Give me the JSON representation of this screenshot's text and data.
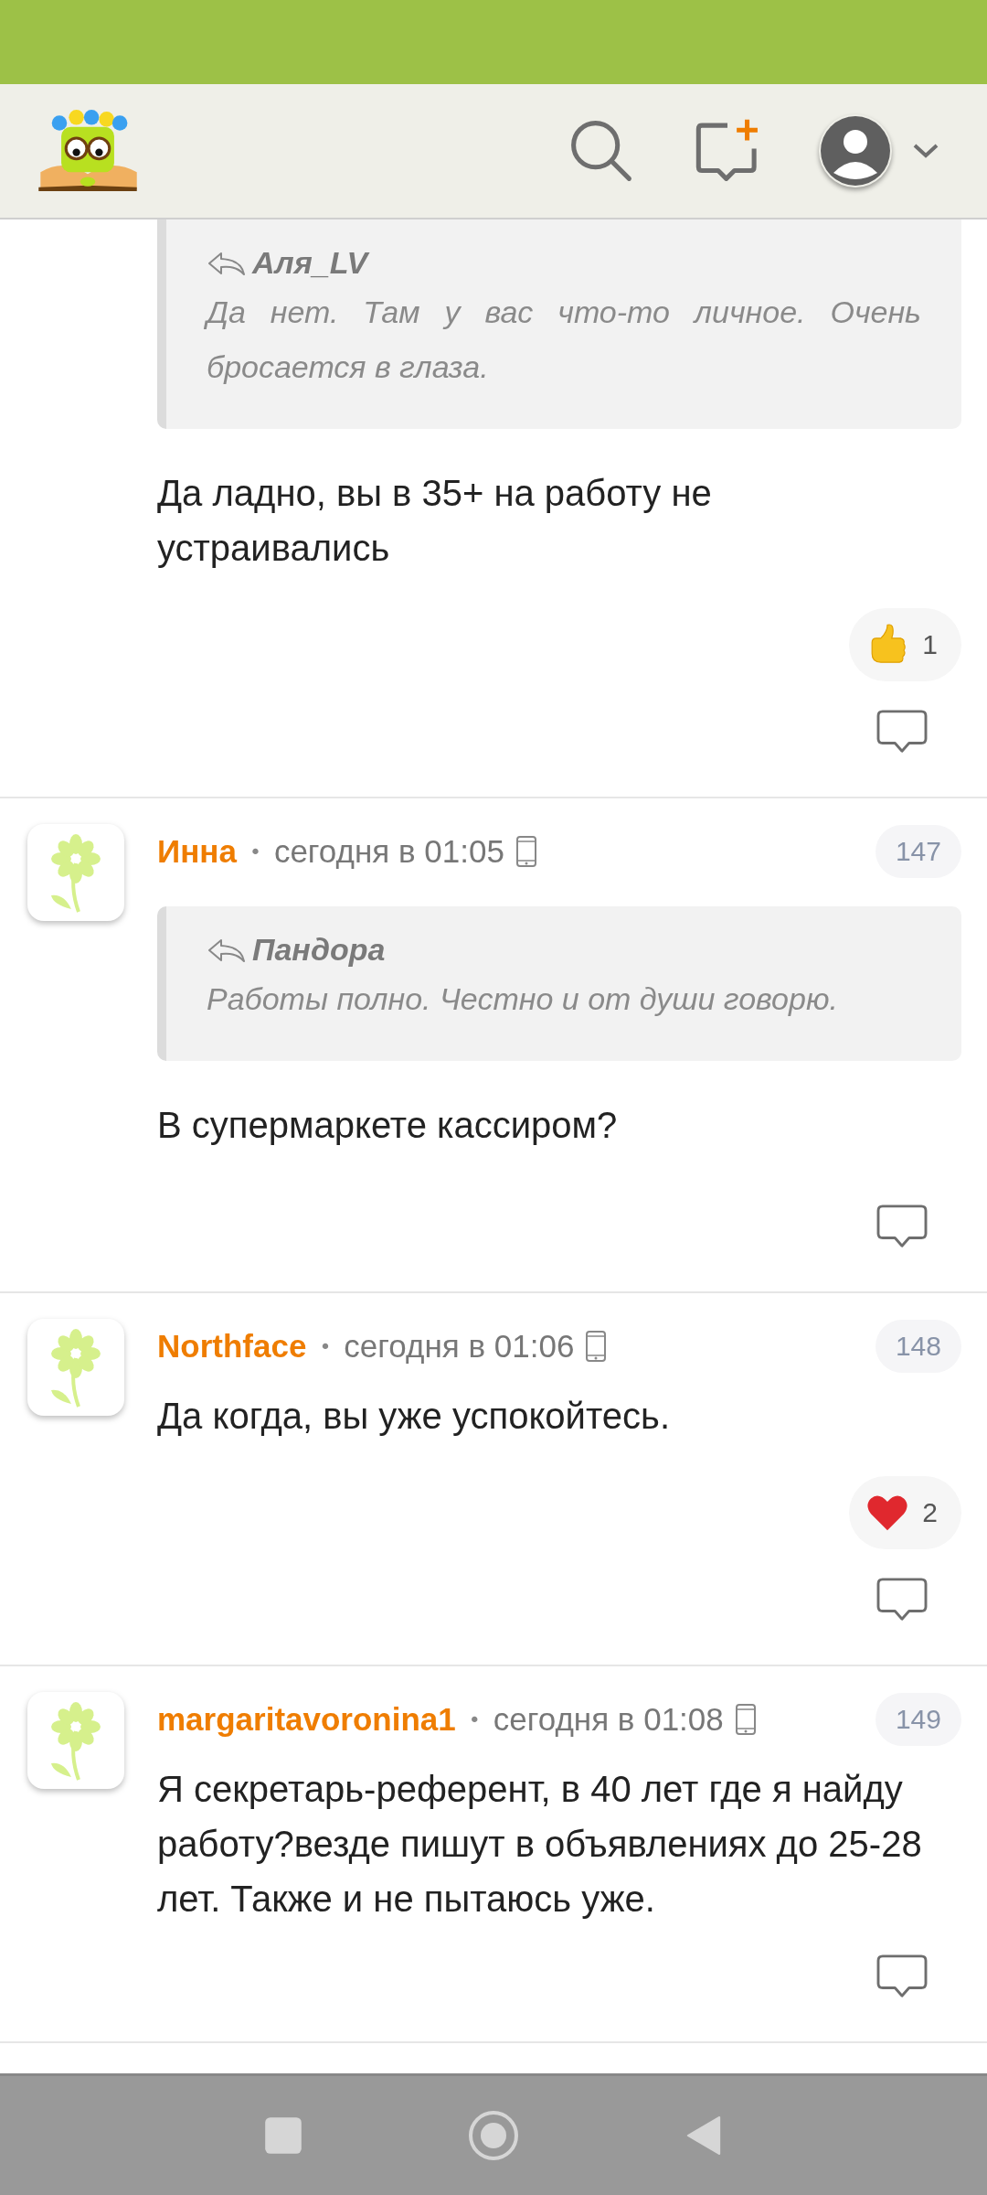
{
  "comments": [
    {
      "quote": {
        "author": "Аля_LV",
        "text": "Да нет. Там у вас что-то личное. Очень бросается в глаза."
      },
      "text": "Да ладно, вы в 35+ на работу не устраивались",
      "reactions": [
        {
          "kind": "like",
          "count": "1"
        }
      ]
    },
    {
      "author": "Инна",
      "separator": "•",
      "time": "сегодня в 01:05",
      "number": "147",
      "quote": {
        "author": "Пандора",
        "text": "Работы полно. Честно и от души говорю."
      },
      "text": "В супермаркете кассиром?"
    },
    {
      "author": "Northface",
      "separator": "•",
      "time": "сегодня в 01:06",
      "number": "148",
      "text": "Да когда, вы уже успокойтесь.",
      "reactions": [
        {
          "kind": "heart",
          "count": "2"
        }
      ]
    },
    {
      "author": "margaritavoronina1",
      "separator": "•",
      "time": "сегодня в 01:08",
      "number": "149",
      "text": "Я секретарь-референт, в 40 лет где я найду работу?везде пишут в объявлениях до 25-28 лет. Также и не пытаюсь уже."
    }
  ]
}
